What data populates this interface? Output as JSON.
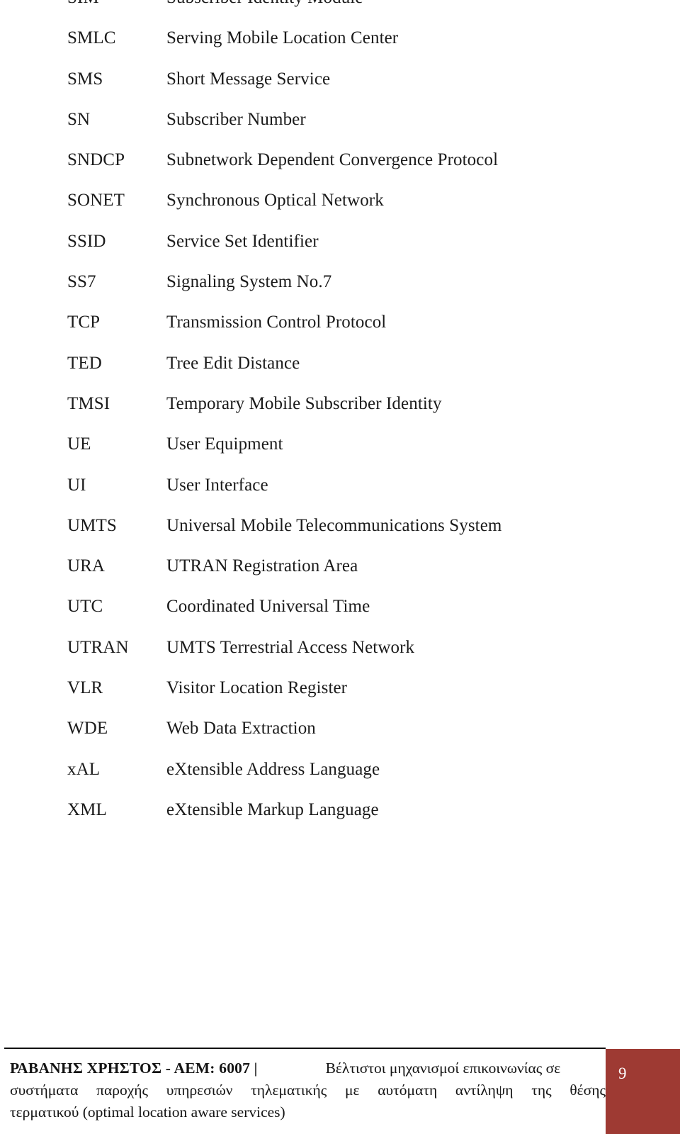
{
  "document": {
    "type": "abbreviations-glossary",
    "abbreviations": [
      {
        "term": "SIM",
        "definition": "Subscriber Identity Module"
      },
      {
        "term": "SMLC",
        "definition": "Serving Mobile Location Center"
      },
      {
        "term": "SMS",
        "definition": "Short Message Service"
      },
      {
        "term": "SN",
        "definition": "Subscriber Number"
      },
      {
        "term": "SNDCP",
        "definition": "Subnetwork Dependent Convergence Protocol"
      },
      {
        "term": "SONET",
        "definition": "Synchronous Optical Network"
      },
      {
        "term": "SSID",
        "definition": "Service Set Identifier"
      },
      {
        "term": "SS7",
        "definition": "Signaling System No.7"
      },
      {
        "term": "TCP",
        "definition": "Transmission Control Protocol"
      },
      {
        "term": "TED",
        "definition": "Tree Edit Distance"
      },
      {
        "term": "TMSI",
        "definition": "Temporary Mobile Subscriber Identity"
      },
      {
        "term": "UE",
        "definition": "User Equipment"
      },
      {
        "term": "UI",
        "definition": "User Interface"
      },
      {
        "term": "UMTS",
        "definition": "Universal Mobile Telecommunications System"
      },
      {
        "term": "URA",
        "definition": "UTRAN Registration Area"
      },
      {
        "term": "UTC",
        "definition": "Coordinated Universal Time"
      },
      {
        "term": "UTRAN",
        "definition": "UMTS Terrestrial Access Network"
      },
      {
        "term": "VLR",
        "definition": "Visitor Location Register"
      },
      {
        "term": "WDE",
        "definition": "Web Data Extraction"
      },
      {
        "term": "xAL",
        "definition": "eXtensible Address Language"
      },
      {
        "term": "XML",
        "definition": "eXtensible Markup Language"
      }
    ]
  },
  "footer": {
    "author": "ΡΑΒΑΝΗΣ ΧΡΗΣΤΟΣ - ΑΕΜ: 6007 |",
    "title_line1": "Βέλτιστοι μηχανισμοί επικοινωνίας σε",
    "title_line2": "συστήματα παροχής υπηρεσιών τηλεματικής με αυτόματη αντίληψη της θέσης",
    "title_line3": "τερματικού (optimal location aware services)",
    "page_number": "9",
    "badge_color": "#9e3a33"
  }
}
